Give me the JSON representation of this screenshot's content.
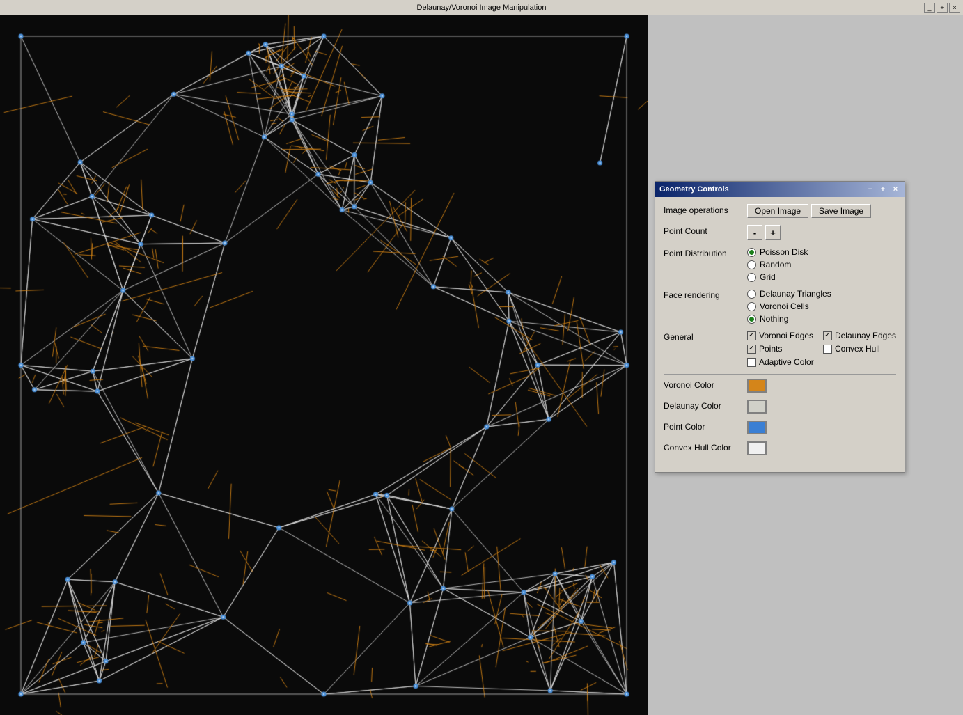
{
  "window": {
    "title": "Delaunay/Voronoi Image Manipulation",
    "minimize_label": "_",
    "maximize_label": "+",
    "close_label": "×"
  },
  "control_panel": {
    "title": "Geometry Controls",
    "minimize_label": "−",
    "maximize_label": "+",
    "close_label": "×",
    "image_operations_label": "Image operations",
    "open_image_label": "Open Image",
    "save_image_label": "Save Image",
    "point_count_label": "Point Count",
    "minus_label": "-",
    "plus_label": "+",
    "point_distribution_label": "Point Distribution",
    "distributions": [
      {
        "id": "poisson",
        "label": "Poisson Disk",
        "checked": true
      },
      {
        "id": "random",
        "label": "Random",
        "checked": false
      },
      {
        "id": "grid",
        "label": "Grid",
        "checked": false
      }
    ],
    "face_rendering_label": "Face rendering",
    "face_options": [
      {
        "id": "delaunay",
        "label": "Delaunay Triangles",
        "checked": false
      },
      {
        "id": "voronoi",
        "label": "Voronoi Cells",
        "checked": false
      },
      {
        "id": "nothing",
        "label": "Nothing",
        "checked": true
      }
    ],
    "general_label": "General",
    "general_checkboxes": [
      {
        "id": "voronoi-edges",
        "label": "Voronoi Edges",
        "checked": true
      },
      {
        "id": "delaunay-edges",
        "label": "Delaunay Edges",
        "checked": true
      },
      {
        "id": "points",
        "label": "Points",
        "checked": true
      },
      {
        "id": "convex-hull",
        "label": "Convex Hull",
        "checked": false
      },
      {
        "id": "adaptive-color",
        "label": "Adaptive Color",
        "checked": false
      }
    ],
    "voronoi_color_label": "Voronoi Color",
    "voronoi_color": "#d4851a",
    "delaunay_color_label": "Delaunay Color",
    "delaunay_color": "#d0d0c8",
    "point_color_label": "Point Color",
    "point_color": "#3a7fd4",
    "convex_hull_color_label": "Convex Hull Color",
    "convex_hull_color": "#f0f0f0"
  },
  "canvas": {
    "background": "#0a0a0a"
  }
}
